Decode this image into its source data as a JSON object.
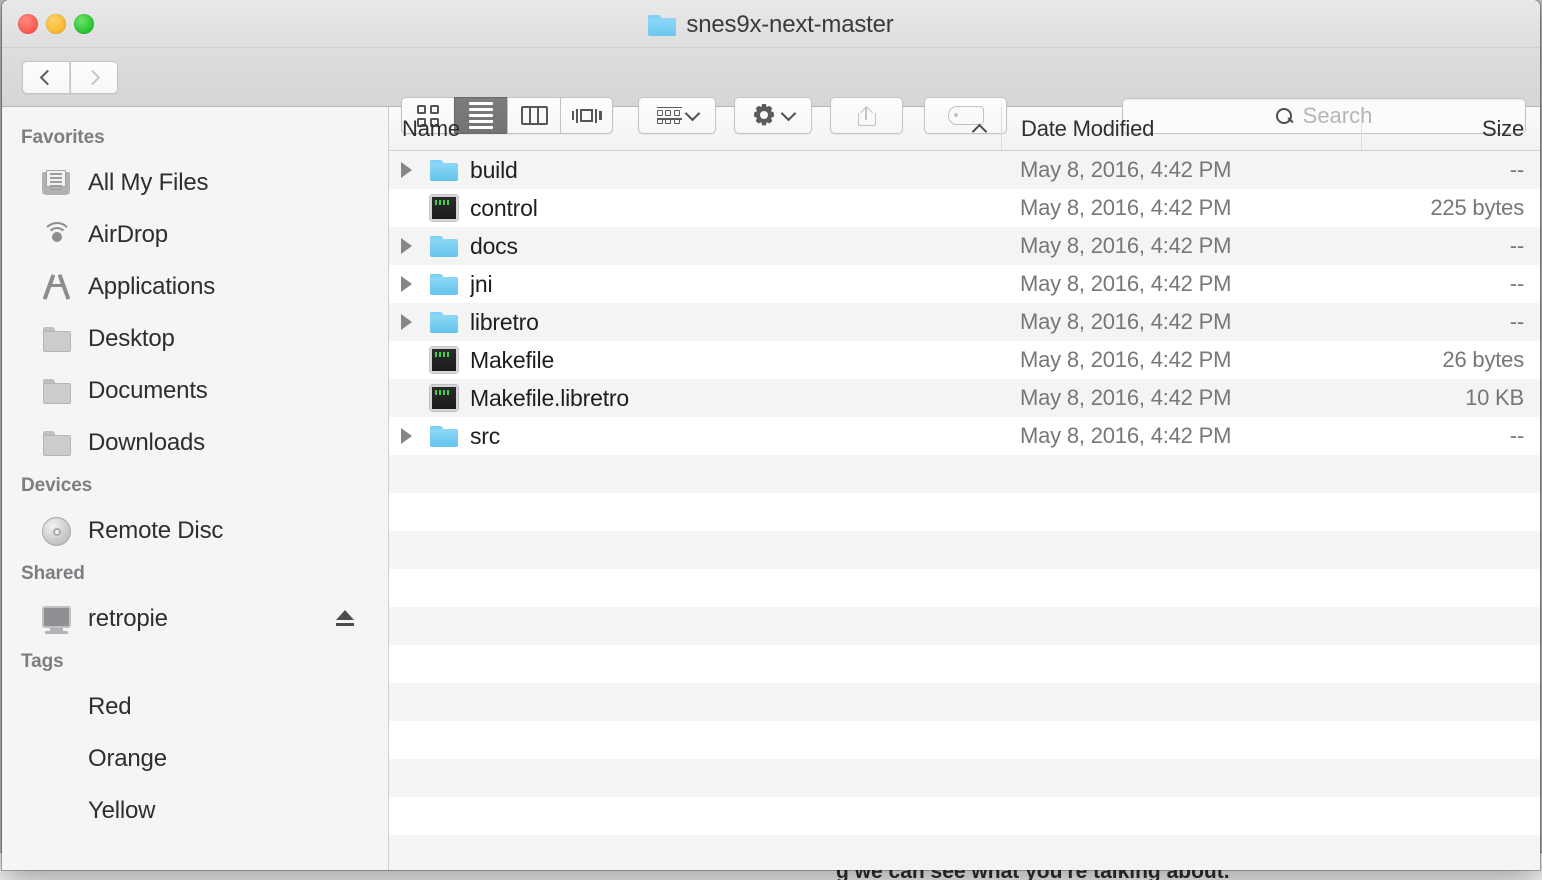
{
  "desktop": {
    "background_text_fragment": "g we can see what you're talking about."
  },
  "window": {
    "title": "snes9x-next-master",
    "title_icon": "folder-icon"
  },
  "traffic_lights": [
    {
      "name": "close-button",
      "color": "#f9564d"
    },
    {
      "name": "minimize-button",
      "color": "#f6b52b"
    },
    {
      "name": "maximize-button",
      "color": "#1fc12c"
    }
  ],
  "toolbar": {
    "back_label": "Back",
    "forward_label": "Forward",
    "view_modes": [
      {
        "id": "icon-view",
        "icon": "grid-icon",
        "active": false
      },
      {
        "id": "list-view",
        "icon": "list-icon",
        "active": true
      },
      {
        "id": "column-view",
        "icon": "columns-icon",
        "active": false
      },
      {
        "id": "flow-view",
        "icon": "coverflow-icon",
        "active": false
      }
    ],
    "arrange": {
      "label": "Arrange By",
      "icon": "arrange-icon"
    },
    "action": {
      "label": "Action",
      "icon": "gear-icon"
    },
    "share": {
      "label": "Share",
      "icon": "share-icon",
      "enabled": false
    },
    "tags": {
      "label": "Edit Tags",
      "icon": "tag-icon",
      "enabled": false
    }
  },
  "search": {
    "placeholder": "Search",
    "value": "",
    "icon": "search-icon"
  },
  "sidebar": {
    "sections": [
      {
        "header": "Favorites",
        "items": [
          {
            "label": "All My Files",
            "icon": "all-my-files-icon"
          },
          {
            "label": "AirDrop",
            "icon": "airdrop-icon"
          },
          {
            "label": "Applications",
            "icon": "applications-icon"
          },
          {
            "label": "Desktop",
            "icon": "folder-icon"
          },
          {
            "label": "Documents",
            "icon": "folder-icon"
          },
          {
            "label": "Downloads",
            "icon": "folder-icon"
          }
        ]
      },
      {
        "header": "Devices",
        "items": [
          {
            "label": "Remote Disc",
            "icon": "disc-icon"
          }
        ]
      },
      {
        "header": "Shared",
        "items": [
          {
            "label": "retropie",
            "icon": "computer-icon",
            "eject": true
          }
        ]
      },
      {
        "header": "Tags",
        "items": [
          {
            "label": "Red",
            "icon": "tag-dot",
            "color": "#f8544c"
          },
          {
            "label": "Orange",
            "icon": "tag-dot",
            "color": "#ee9526"
          },
          {
            "label": "Yellow",
            "icon": "tag-dot",
            "color": "#f0c932"
          }
        ]
      }
    ]
  },
  "filelist": {
    "columns": [
      {
        "key": "name",
        "label": "Name",
        "sorted": true,
        "direction": "asc"
      },
      {
        "key": "date",
        "label": "Date Modified",
        "sorted": false,
        "direction": ""
      },
      {
        "key": "size",
        "label": "Size",
        "sorted": false,
        "direction": ""
      }
    ],
    "sort_caret": "chevron-up-icon",
    "rows": [
      {
        "name": "build",
        "date": "May 8, 2016, 4:42 PM",
        "size": "--",
        "kind": "folder",
        "expandable": true
      },
      {
        "name": "control",
        "date": "May 8, 2016, 4:42 PM",
        "size": "225 bytes",
        "kind": "unix",
        "expandable": false
      },
      {
        "name": "docs",
        "date": "May 8, 2016, 4:42 PM",
        "size": "--",
        "kind": "folder",
        "expandable": true
      },
      {
        "name": "jni",
        "date": "May 8, 2016, 4:42 PM",
        "size": "--",
        "kind": "folder",
        "expandable": true
      },
      {
        "name": "libretro",
        "date": "May 8, 2016, 4:42 PM",
        "size": "--",
        "kind": "folder",
        "expandable": true
      },
      {
        "name": "Makefile",
        "date": "May 8, 2016, 4:42 PM",
        "size": "26 bytes",
        "kind": "unix",
        "expandable": false
      },
      {
        "name": "Makefile.libretro",
        "date": "May 8, 2016, 4:42 PM",
        "size": "10 KB",
        "kind": "unix",
        "expandable": false
      },
      {
        "name": "src",
        "date": "May 8, 2016, 4:42 PM",
        "size": "--",
        "kind": "folder",
        "expandable": true
      }
    ],
    "empty_row_count": 11
  }
}
